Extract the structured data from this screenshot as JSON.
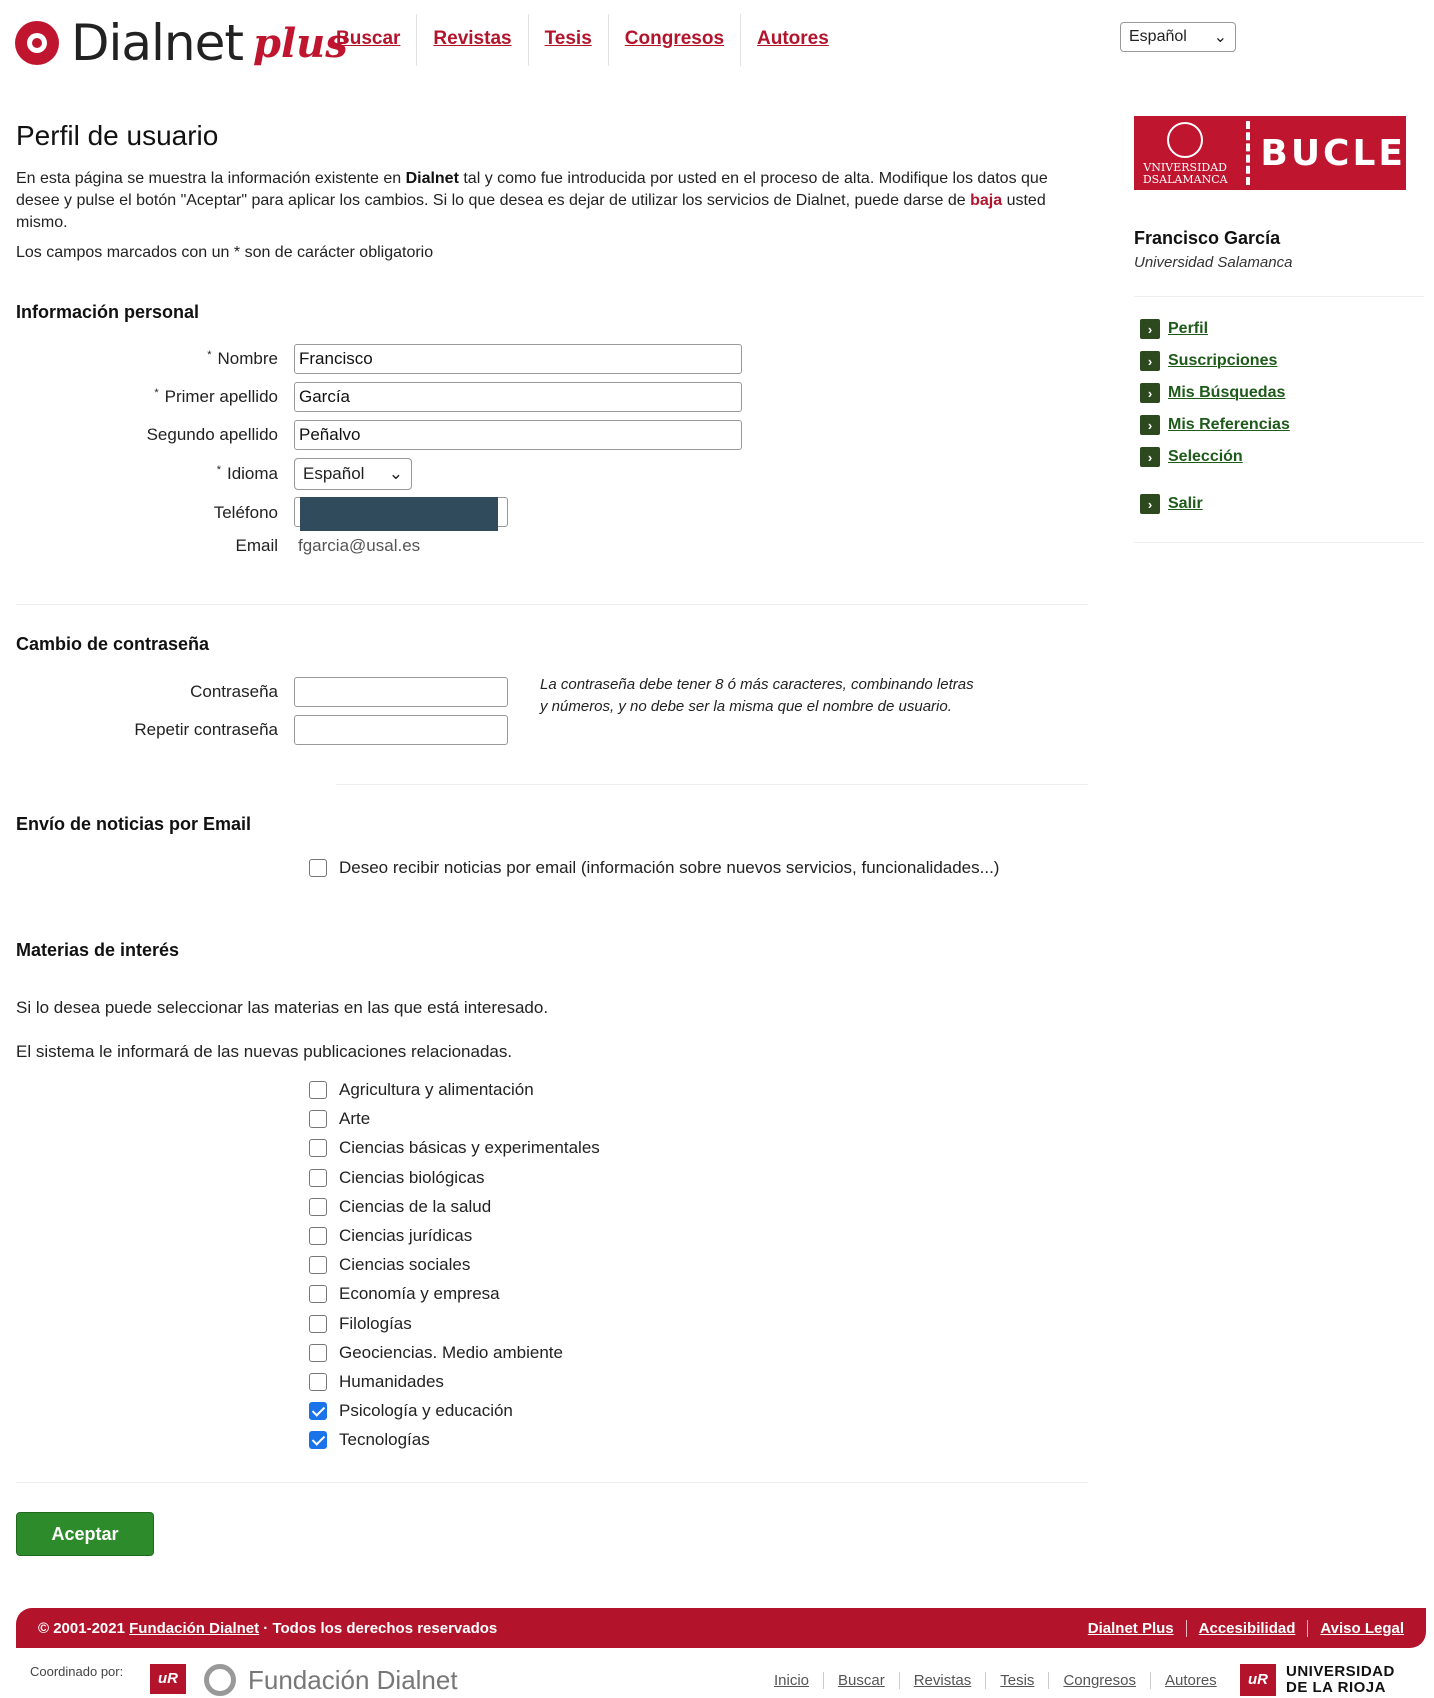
{
  "header": {
    "logo_text": "Dialnet",
    "logo_plus": "plus",
    "nav": [
      "Buscar",
      "Revistas",
      "Tesis",
      "Congresos",
      "Autores"
    ],
    "language": "Español"
  },
  "main": {
    "title": "Perfil de usuario",
    "intro_1": "En esta página se muestra la información existente en ",
    "intro_bold": "Dialnet",
    "intro_2": " tal y como fue introducida por usted en el proceso de alta. Modifique los datos que desee y pulse el botón \"Aceptar\" para aplicar los cambios. Si lo que desea es dejar de utilizar los servicios de Dialnet, puede darse de ",
    "intro_link": "baja",
    "intro_3": " usted mismo.",
    "required_note": "Los campos marcados con un * son de carácter obligatorio"
  },
  "personal": {
    "section_title": "Información personal",
    "nombre_label": "Nombre",
    "nombre_value": "Francisco",
    "apellido1_label": "Primer apellido",
    "apellido1_value": "García",
    "apellido2_label": "Segundo apellido",
    "apellido2_value": "Peñalvo",
    "idioma_label": "Idioma",
    "idioma_value": "Español",
    "telefono_label": "Teléfono",
    "email_label": "Email",
    "email_value": "fgarcia@usal.es",
    "required_mark": "*"
  },
  "password": {
    "section_title": "Cambio de contraseña",
    "pwd_label": "Contraseña",
    "pwd_repeat_label": "Repetir contraseña",
    "hint": "La contraseña debe tener 8 ó más caracteres, combinando letras y números, y no debe ser la misma que el nombre de usuario."
  },
  "news": {
    "section_title": "Envío de noticias por Email",
    "checkbox_label": "Deseo recibir noticias por email (información sobre nuevos servicios, funcionalidades...)",
    "checked": false
  },
  "topics": {
    "section_title": "Materias de interés",
    "text_1": "Si lo desea puede seleccionar las materias en las que está interesado.",
    "text_2": "El sistema le informará de las nuevas publicaciones relacionadas.",
    "items": [
      {
        "label": "Agricultura y alimentación",
        "checked": false
      },
      {
        "label": "Arte",
        "checked": false
      },
      {
        "label": "Ciencias básicas y experimentales",
        "checked": false
      },
      {
        "label": "Ciencias biológicas",
        "checked": false
      },
      {
        "label": "Ciencias de la salud",
        "checked": false
      },
      {
        "label": "Ciencias jurídicas",
        "checked": false
      },
      {
        "label": "Ciencias sociales",
        "checked": false
      },
      {
        "label": "Economía y empresa",
        "checked": false
      },
      {
        "label": "Filologías",
        "checked": false
      },
      {
        "label": "Geociencias. Medio ambiente",
        "checked": false
      },
      {
        "label": "Humanidades",
        "checked": false
      },
      {
        "label": "Psicología y educación",
        "checked": true
      },
      {
        "label": "Tecnologías",
        "checked": true
      }
    ]
  },
  "accept_label": "Aceptar",
  "sidebar": {
    "uni_name": "VNIVERSIDAD DSALAMANCA",
    "bucle": "BUCLE",
    "user_name": "Francisco García",
    "user_org": "Universidad Salamanca",
    "menu": [
      "Perfil",
      "Suscripciones",
      "Mis Búsquedas",
      "Mis Referencias",
      "Selección"
    ],
    "logout": "Salir"
  },
  "footer": {
    "copyright_prefix": "© 2001-2021 ",
    "copyright_link": "Fundación Dialnet",
    "copyright_suffix": " · Todos los derechos reservados",
    "links": [
      "Dialnet Plus",
      "Accesibilidad",
      "Aviso Legal"
    ],
    "coordinated_by": "Coordinado por:",
    "fundacion": "Fundación Dialnet",
    "bottom_links": [
      "Inicio",
      "Buscar",
      "Revistas",
      "Tesis",
      "Congresos",
      "Autores"
    ],
    "uni_rioja_1": "UNIVERSIDAD",
    "uni_rioja_2": "DE LA RIOJA",
    "rioja_mark": "uR"
  },
  "colors": {
    "brand_red": "#b3142c",
    "accept_green": "#2e8b2b",
    "sidebar_green": "#1e5a1a",
    "checkbox_blue": "#1a73e8"
  }
}
